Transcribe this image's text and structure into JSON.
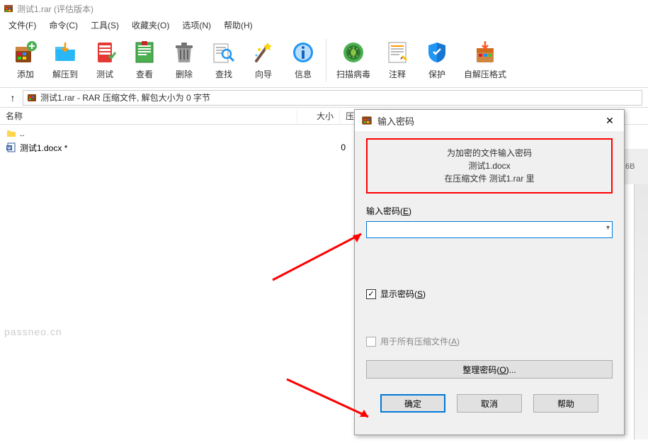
{
  "title_bar": {
    "title": "测试1.rar (评估版本)"
  },
  "menu": {
    "file": "文件(F)",
    "command": "命令(C)",
    "tools": "工具(S)",
    "favorites": "收藏夹(O)",
    "options": "选项(N)",
    "help": "帮助(H)"
  },
  "toolbar": {
    "add": "添加",
    "extract": "解压到",
    "test": "测试",
    "view": "查看",
    "delete": "删除",
    "find": "查找",
    "wizard": "向导",
    "info": "信息",
    "scan": "扫描病毒",
    "comment": "注释",
    "protect": "保护",
    "self_extract": "自解压格式"
  },
  "path_bar": {
    "text": "测试1.rar - RAR 压缩文件, 解包大小为 0 字节"
  },
  "columns": {
    "name": "名称",
    "size": "大小",
    "compressed": "压缩"
  },
  "files": {
    "up": "..",
    "row1": {
      "name": "测试1.docx *",
      "size": "0"
    }
  },
  "right_edge": "6B",
  "watermark": "passneo.cn",
  "dialog": {
    "title": "输入密码",
    "info1": "为加密的文件输入密码",
    "info2": "测试1.docx",
    "info3": "在压缩文件 测试1.rar 里",
    "password_label_pre": "输入密码(",
    "password_label_u": "E",
    "password_label_post": ")",
    "show_password_pre": "显示密码(",
    "show_password_u": "S",
    "show_password_post": ")",
    "all_archives_pre": "用于所有压缩文件(",
    "all_archives_u": "A",
    "all_archives_post": ")",
    "organize_pre": "整理密码(",
    "organize_u": "O",
    "organize_post": ")...",
    "ok": "确定",
    "cancel": "取消",
    "help": "帮助"
  }
}
